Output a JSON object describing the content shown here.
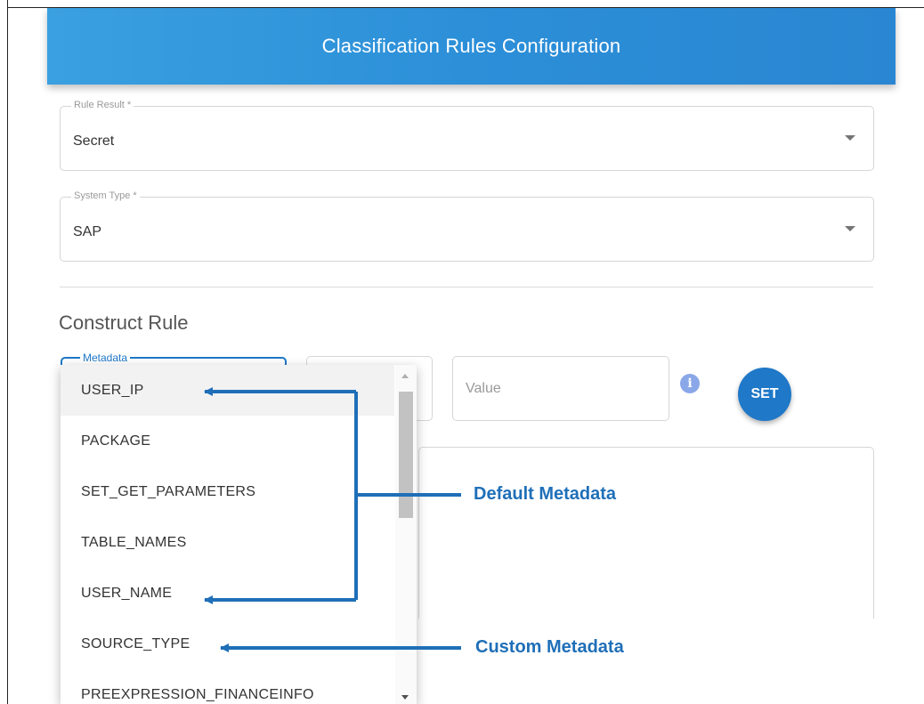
{
  "header": {
    "title": "Classification Rules Configuration"
  },
  "rule_result": {
    "label": "Rule Result *",
    "value": "Secret"
  },
  "system_type": {
    "label": "System Type *",
    "value": "SAP"
  },
  "construct_rule": {
    "title": "Construct Rule",
    "metadata_label": "Metadata",
    "value_placeholder": "Value",
    "info_icon": "i",
    "set_label": "SET"
  },
  "metadata_options": [
    "USER_IP",
    "PACKAGE",
    "SET_GET_PARAMETERS",
    "TABLE_NAMES",
    "USER_NAME",
    "SOURCE_TYPE",
    "PREEXPRESSION_FINANCEINFO"
  ],
  "annotations": {
    "default_metadata": "Default Metadata",
    "custom_metadata": "Custom Metadata"
  },
  "colors": {
    "accent": "#1f78c8",
    "header": "#2c8fd8",
    "annotation": "#1f6fb8"
  }
}
